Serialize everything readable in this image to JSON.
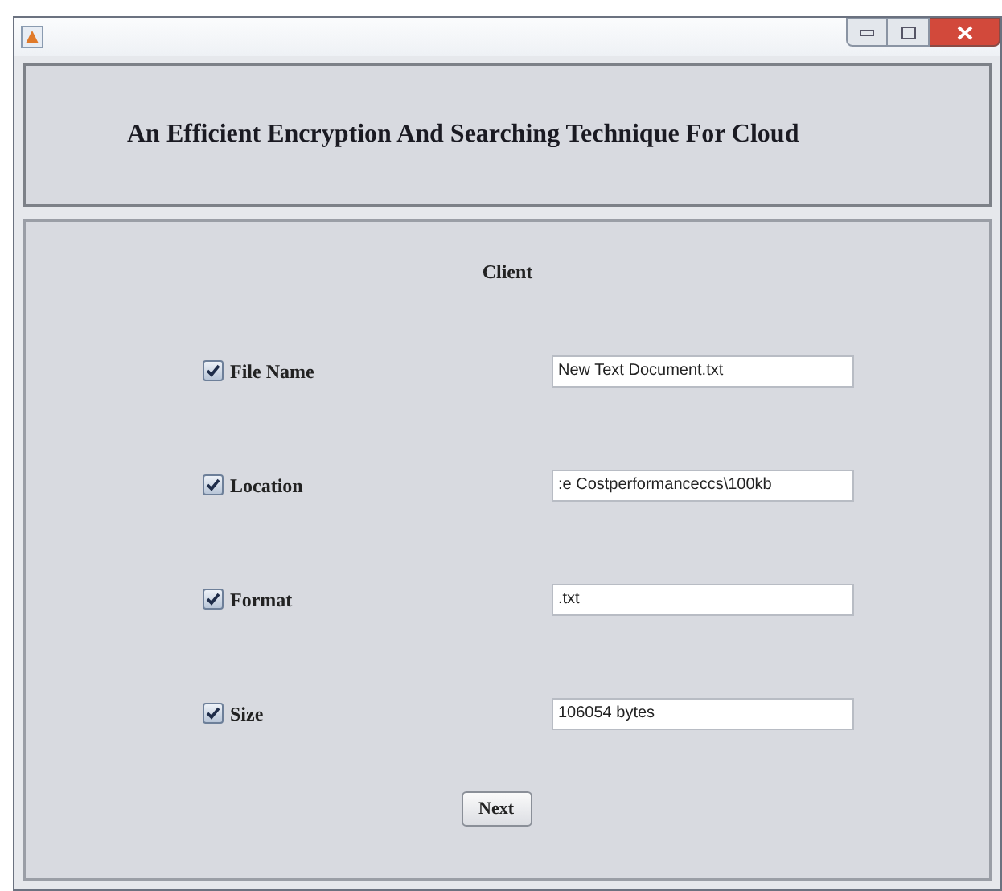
{
  "header": {
    "title": "An Efficient Encryption And Searching Technique For Cloud"
  },
  "panel": {
    "title": "Client"
  },
  "fields": [
    {
      "label": "File Name",
      "checked": true,
      "value": "New Text Document.txt"
    },
    {
      "label": "Location",
      "checked": true,
      "value": ":e Costperformanceccs\\100kb"
    },
    {
      "label": "Format",
      "checked": true,
      "value": ".txt"
    },
    {
      "label": "Size",
      "checked": true,
      "value": "106054 bytes"
    }
  ],
  "buttons": [
    {
      "label": "Next"
    }
  ]
}
